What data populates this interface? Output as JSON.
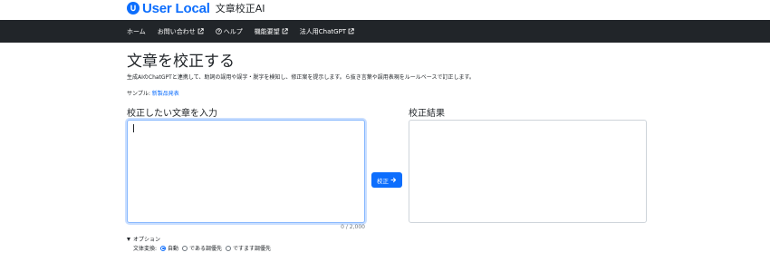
{
  "header": {
    "brand": "User Local",
    "product": "文章校正AI"
  },
  "nav": {
    "items": [
      {
        "label": "ホーム",
        "icon": "none"
      },
      {
        "label": "お問い合わせ",
        "icon": "external-link-icon"
      },
      {
        "label": "ヘルプ",
        "icon": "question-circle-icon"
      },
      {
        "label": "機能要望",
        "icon": "external-link-icon"
      },
      {
        "label": "法人用ChatGPT",
        "icon": "external-link-icon"
      }
    ]
  },
  "main": {
    "title": "文章を校正する",
    "description": "生成AIのChatGPTと連携して、助詞の誤用や誤字・脱字を検知し、修正案を提示します。ら抜き言葉や誤用表現をルールベースで訂正します。",
    "sample_prefix": "サンプル:",
    "sample_link": "新製品発表",
    "input_label": "校正したい文章を入力",
    "input_value": "",
    "result_label": "校正結果",
    "counter": "0 / 2,000",
    "correct_button": "校正"
  },
  "options": {
    "toggle_label": "オプション",
    "style_label": "文体変換:",
    "choices": [
      {
        "label": "自動",
        "selected": true
      },
      {
        "label": "である調優先",
        "selected": false
      },
      {
        "label": "ですます調優先",
        "selected": false
      }
    ]
  },
  "colors": {
    "brand": "#0d6efd",
    "navbar": "#212529",
    "text": "#212529",
    "muted": "#6c757d"
  }
}
